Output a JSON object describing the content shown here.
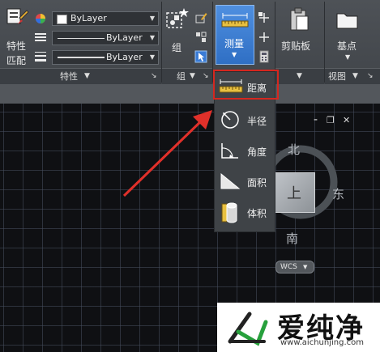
{
  "properties": {
    "match_label_line1": "特性",
    "match_label_line2": "匹配",
    "color_value": "ByLayer",
    "linetype_value": "ByLayer",
    "lineweight_value": "ByLayer",
    "panel_title": "特性"
  },
  "groups": {
    "group_label": "组",
    "panel_title": "组"
  },
  "utilities": {
    "measure_label": "测量"
  },
  "clipboard": {
    "paste_label": "剪贴板"
  },
  "view": {
    "base_label": "基点",
    "panel_title": "视图"
  },
  "measure_menu": {
    "items": [
      {
        "label": "距离",
        "icon": "distance-icon"
      },
      {
        "label": "半径",
        "icon": "radius-icon"
      },
      {
        "label": "角度",
        "icon": "angle-icon"
      },
      {
        "label": "面积",
        "icon": "area-icon"
      },
      {
        "label": "体积",
        "icon": "volume-icon"
      }
    ]
  },
  "viewcube": {
    "north": "北",
    "south": "南",
    "east": "东",
    "face": "上",
    "wcs": "WCS"
  },
  "viewport_controls": {
    "minimize": "-",
    "restore": "❐",
    "close": "✕"
  },
  "watermark": {
    "brand": "爱纯净",
    "url": "www.aichunjing.com"
  },
  "colors": {
    "highlight_red": "#d5271f",
    "arrow_red": "#e0302a",
    "ribbon_bg": "#45494e",
    "active_blue": "#3a7bd5"
  }
}
